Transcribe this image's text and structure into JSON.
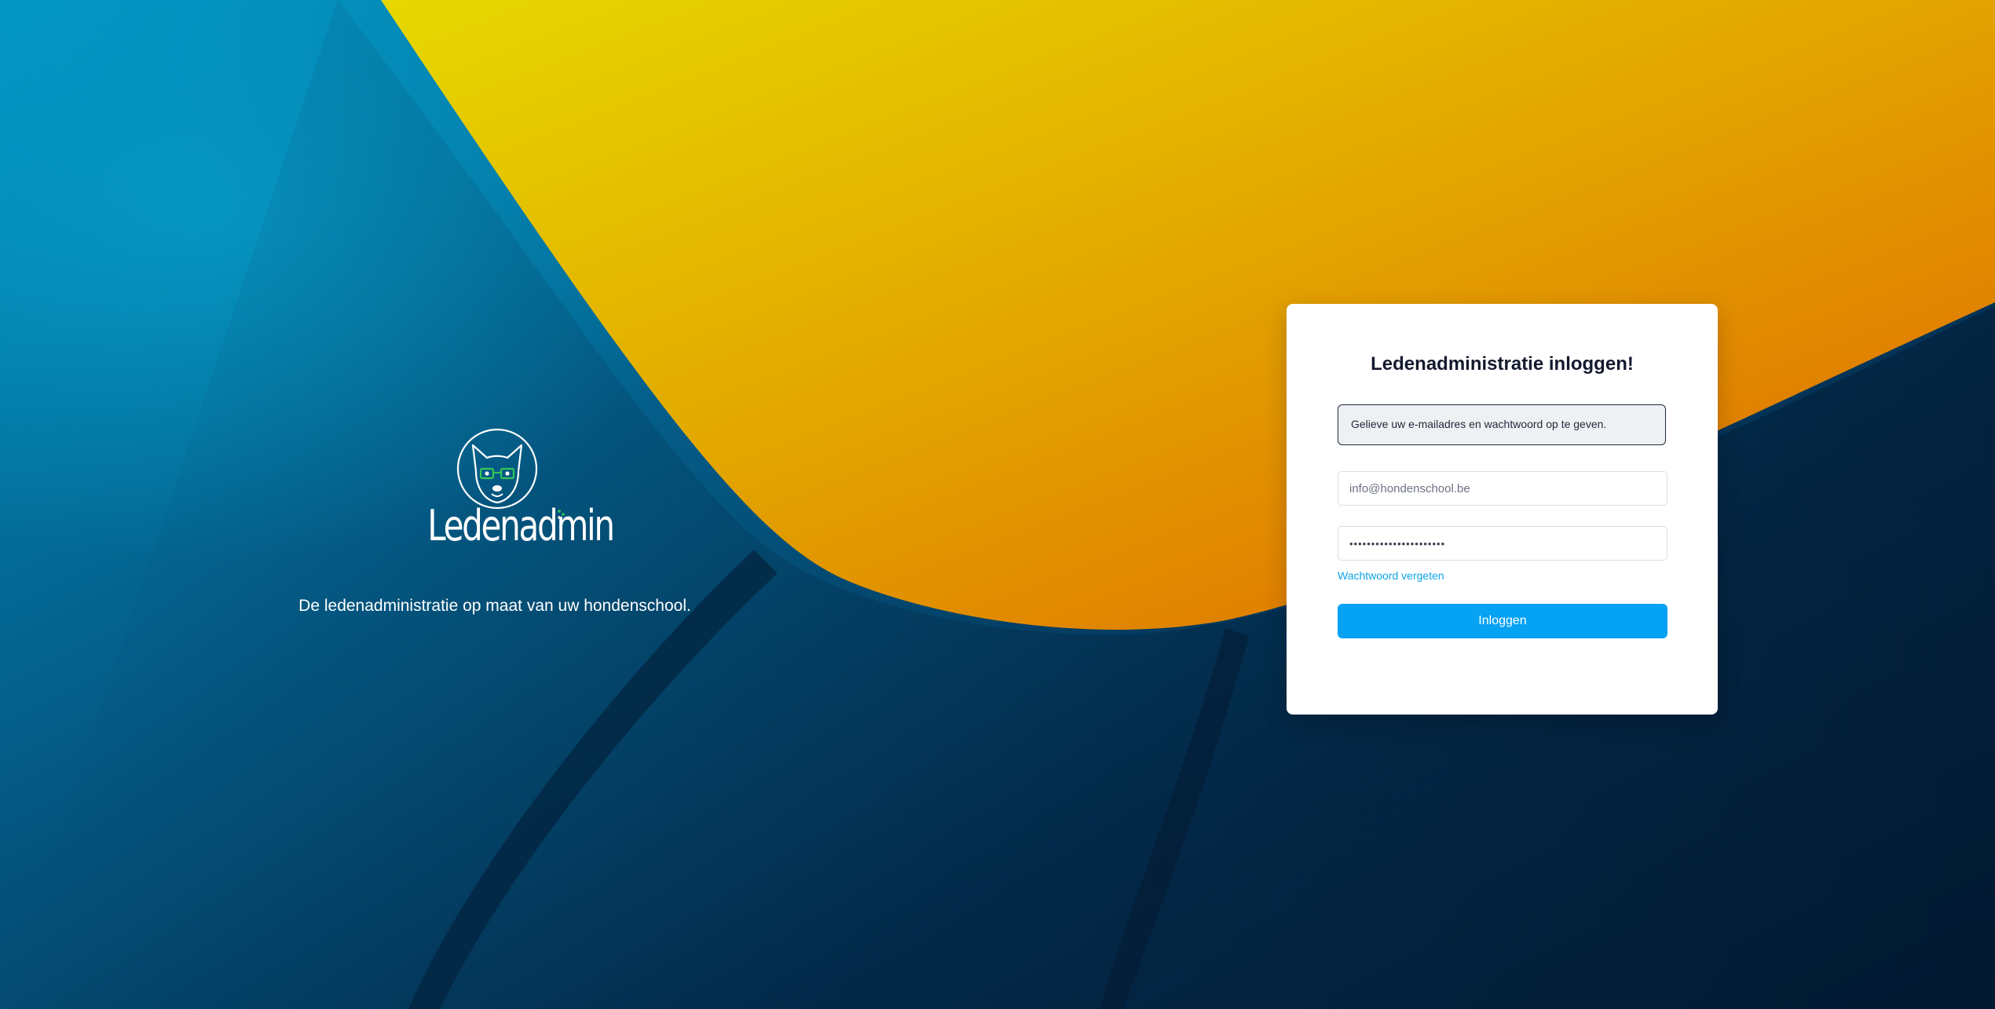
{
  "brand": {
    "logo_text": "Ledenadmin",
    "tagline": "De ledenadministratie op maat van uw hondenschool."
  },
  "login": {
    "title": "Ledenadministratie inloggen!",
    "notice": "Gelieve uw e-mailadres en wachtwoord op te geven.",
    "email_value": "info@hondenschool.be",
    "password_value": "••••••••••••••••••••••",
    "forgot_label": "Wachtwoord vergeten",
    "submit_label": "Inloggen"
  },
  "icons": {
    "logo": "dog-with-glasses-icon"
  },
  "colors": {
    "accent": "#06a2f4",
    "link": "#0ea5e9",
    "logo_glasses": "#35c759",
    "background_blue": "#0089b8",
    "background_navy": "#03203a",
    "background_yellow": "#e4cf00",
    "background_orange": "#e06a00"
  }
}
